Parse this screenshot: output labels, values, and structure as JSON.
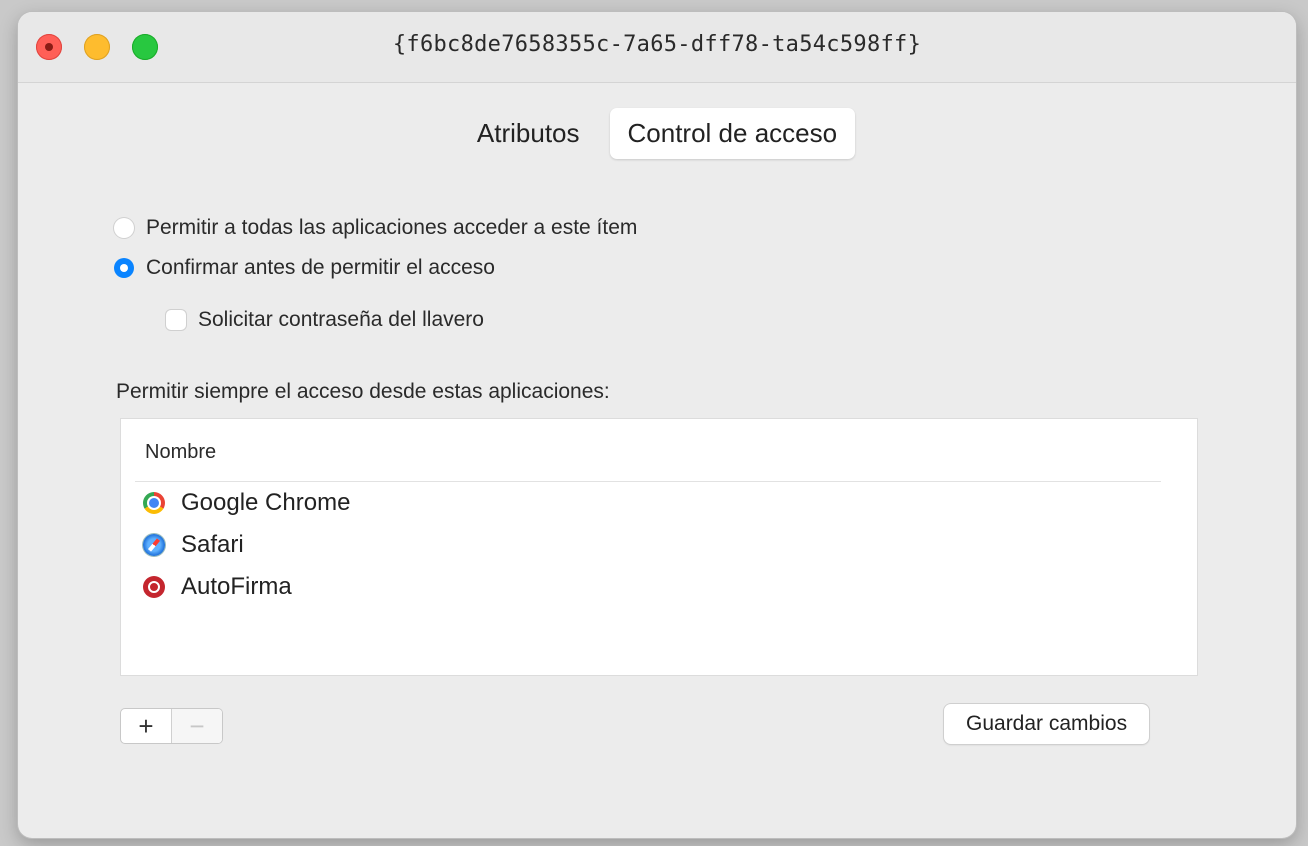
{
  "window": {
    "title": "{f6bc8de7658355c-7a65-dff78-ta54c598ff}"
  },
  "tabs": [
    {
      "label": "Atributos",
      "active": false
    },
    {
      "label": "Control de acceso",
      "active": true
    }
  ],
  "access": {
    "allow_all_label": "Permitir a todas las aplicaciones acceder a este ítem",
    "allow_all_selected": false,
    "confirm_label": "Confirmar antes de permitir el acceso",
    "confirm_selected": true,
    "keychain_password_label": "Solicitar contraseña del llavero",
    "keychain_password_checked": false
  },
  "apps_section": {
    "label": "Permitir siempre el acceso desde estas aplicaciones:",
    "column_header": "Nombre",
    "apps": [
      {
        "name": "Google Chrome",
        "icon": "chrome-icon"
      },
      {
        "name": "Safari",
        "icon": "safari-icon"
      },
      {
        "name": "AutoFirma",
        "icon": "autofirma-icon"
      }
    ]
  },
  "controls": {
    "add_label": "+",
    "remove_label": "−",
    "save_label": "Guardar cambios"
  },
  "colors": {
    "accent": "#0a84ff",
    "close": "#ff5f57",
    "minimize": "#febc2e",
    "zoom": "#28c840"
  }
}
